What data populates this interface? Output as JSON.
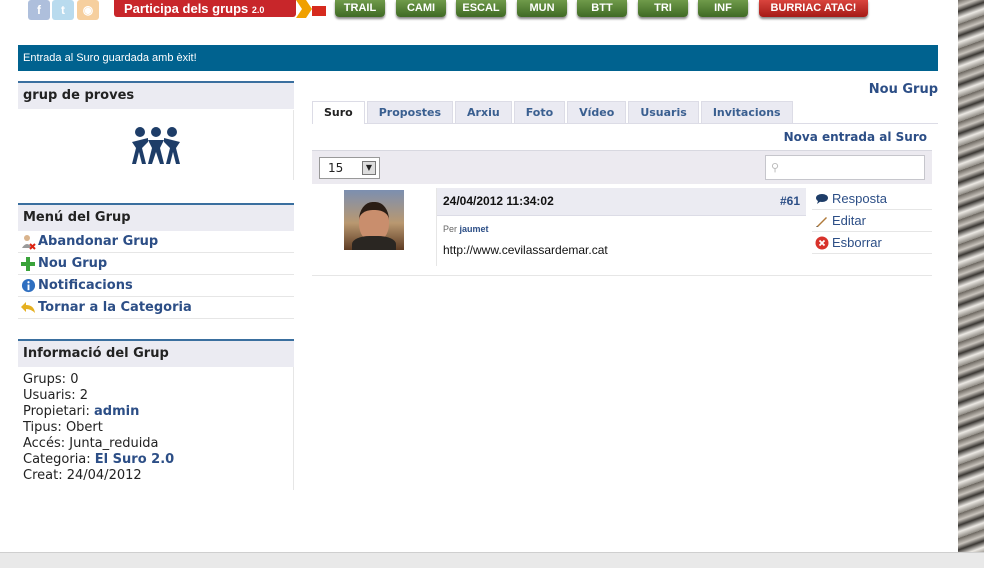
{
  "topbar": {
    "participa_label": "Participa dels grups",
    "participa_version": "2.0",
    "nav": [
      {
        "label": "TRAIL",
        "color": "green"
      },
      {
        "label": "CAMI",
        "color": "green"
      },
      {
        "label": "ESCAL",
        "color": "green"
      },
      {
        "label": "MUN",
        "color": "green"
      },
      {
        "label": "BTT",
        "color": "green"
      },
      {
        "label": "TRI",
        "color": "green"
      },
      {
        "label": "INF",
        "color": "green"
      },
      {
        "label": "BURRIAC ATAC!",
        "color": "red"
      }
    ]
  },
  "status": {
    "message": "Entrada al Suro guardada amb èxit!"
  },
  "sidebar": {
    "group_title": "grup de proves",
    "menu_title": "Menú del Grup",
    "menu": [
      {
        "label": "Abandonar Grup",
        "icon": "user-remove-icon"
      },
      {
        "label": "Nou Grup",
        "icon": "plus-icon"
      },
      {
        "label": "Notificacions",
        "icon": "info-icon"
      },
      {
        "label": "Tornar a la Categoria",
        "icon": "return-arrow-icon"
      }
    ],
    "info_title": "Informació del Grup",
    "info": {
      "groups_label": "Grups:",
      "groups_value": "0",
      "users_label": "Usuaris:",
      "users_value": "2",
      "owner_label": "Propietari:",
      "owner_value": "admin",
      "type_label": "Tipus:",
      "type_value": "Obert",
      "access_label": "Accés:",
      "access_value": "Junta_reduida",
      "category_label": "Categoria:",
      "category_value": "El Suro 2.0",
      "created_label": "Creat:",
      "created_value": "24/04/2012"
    }
  },
  "main": {
    "nou_grup": "Nou Grup",
    "tabs": [
      "Suro",
      "Propostes",
      "Arxiu",
      "Foto",
      "Vídeo",
      "Usuaris",
      "Invitacions"
    ],
    "active_tab": "Suro",
    "nova_entrada": "Nova entrada al Suro",
    "per_page": "15",
    "entry": {
      "date": "24/04/2012 11:34:02",
      "number": "#61",
      "author_prefix": "Per",
      "author": "jaumet",
      "text": "http://www.cevilassardemar.cat",
      "actions": [
        "Resposta",
        "Editar",
        "Esborrar"
      ]
    }
  },
  "colors": {
    "accent": "#00628f",
    "link": "#2c4e86",
    "nav_green": "#4f7a30",
    "nav_red": "#c8262a"
  }
}
